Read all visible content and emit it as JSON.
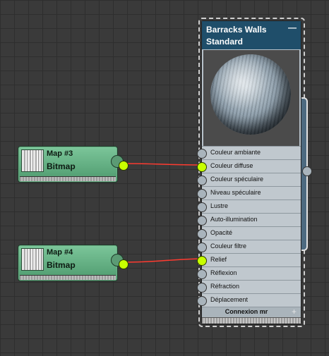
{
  "colors": {
    "wire": "#ff3b30",
    "active_socket": "#c8ff00",
    "map_node": "#6fb38a",
    "material_header": "#1f4e6a",
    "canvas": "#3a3a3a"
  },
  "map_nodes": [
    {
      "name": "Map #3",
      "type": "Bitmap",
      "connected_to": "Couleur diffuse"
    },
    {
      "name": "Map #4",
      "type": "Bitmap",
      "connected_to": "Relief"
    }
  ],
  "material": {
    "name": "Barracks Walls",
    "type": "Standard",
    "collapse_icon": "minus-icon",
    "slots": [
      {
        "label": "Couleur ambiante",
        "connected": false
      },
      {
        "label": "Couleur diffuse",
        "connected": true
      },
      {
        "label": "Couleur spéculaire",
        "connected": false
      },
      {
        "label": "Niveau spéculaire",
        "connected": false
      },
      {
        "label": "Lustre",
        "connected": false
      },
      {
        "label": "Auto-illumination",
        "connected": false
      },
      {
        "label": "Opacité",
        "connected": false
      },
      {
        "label": "Couleur filtre",
        "connected": false
      },
      {
        "label": "Relief",
        "connected": true
      },
      {
        "label": "Réflexion",
        "connected": false
      },
      {
        "label": "Réfraction",
        "connected": false
      },
      {
        "label": "Déplacement",
        "connected": false
      }
    ],
    "footer": {
      "label": "Connexion mr",
      "expand_icon": "plus-icon"
    }
  }
}
